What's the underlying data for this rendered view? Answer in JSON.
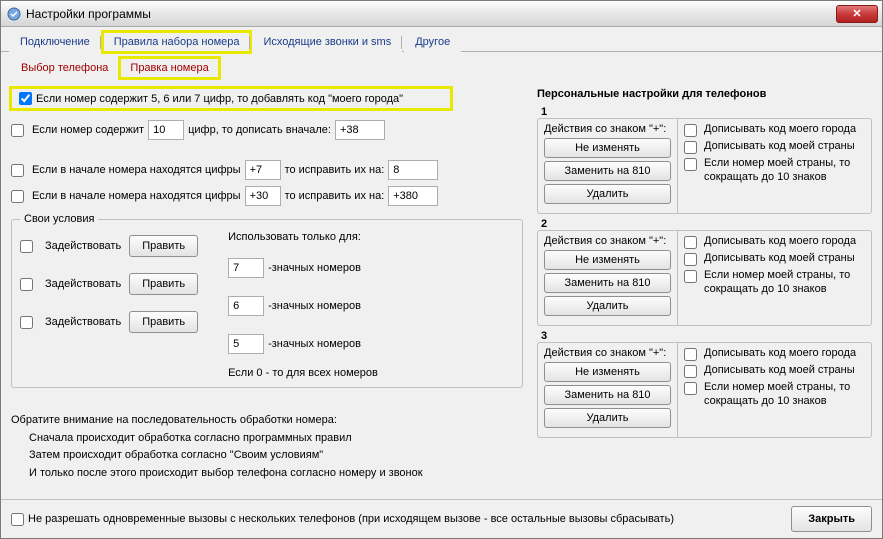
{
  "title": "Настройки программы",
  "tabs": {
    "connection": "Подключение",
    "dialrules": "Правила набора номера",
    "outgoing": "Исходящие звонки и sms",
    "other": "Другое"
  },
  "subtabs": {
    "phone_choice": "Выбор телефона",
    "number_edit": "Правка номера"
  },
  "main": {
    "add_city_code": "Если номер содержит 5, 6 или 7 цифр, то добавлять код \"моего города\"",
    "r2_a": "Если номер содержит",
    "r2_val": "10",
    "r2_b": "цифр, то дописать вначале:",
    "r2_c": "+38",
    "r3_a": "Если в начале номера находятся цифры",
    "r3_v1": "+7",
    "r3_b": "то исправить их на:",
    "r3_v2": "8",
    "r4_v1": "+30",
    "r4_v2": "+380",
    "own_rules_title": "Свои условия",
    "use_only_title": "Использовать только для:",
    "activate": "Задействовать",
    "edit": "Править",
    "digits_suffix": "-значных номеров",
    "u1": "7",
    "u2": "6",
    "u3": "5",
    "zero_note": "Если 0 - то для всех номеров",
    "notes0": "Обратите внимание на последовательность обработки номера:",
    "notes1": "Сначала происходит обработка согласно программных правил",
    "notes2": "Затем происходит обработка согласно \"Своим условиям\"",
    "notes3": "И только после этого происходит выбор телефона согласно номеру и звонок"
  },
  "right": {
    "title": "Персональные настройки для телефонов",
    "num1": "1",
    "num2": "2",
    "num3": "3",
    "plus_label": "Действия со знаком \"+\":",
    "btn_keep": "Не изменять",
    "btn_810": "Заменить на 810",
    "btn_del": "Удалить",
    "cb_city": "Дописывать код моего города",
    "cb_country": "Дописывать код моей страны",
    "cb_short": "Если номер моей страны, то сокращать до 10 знаков"
  },
  "footer": {
    "no_multi": "Не разрешать одновременные вызовы с нескольких телефонов (при исходящем вызове - все остальные вызовы сбрасывать)",
    "close": "Закрыть"
  }
}
